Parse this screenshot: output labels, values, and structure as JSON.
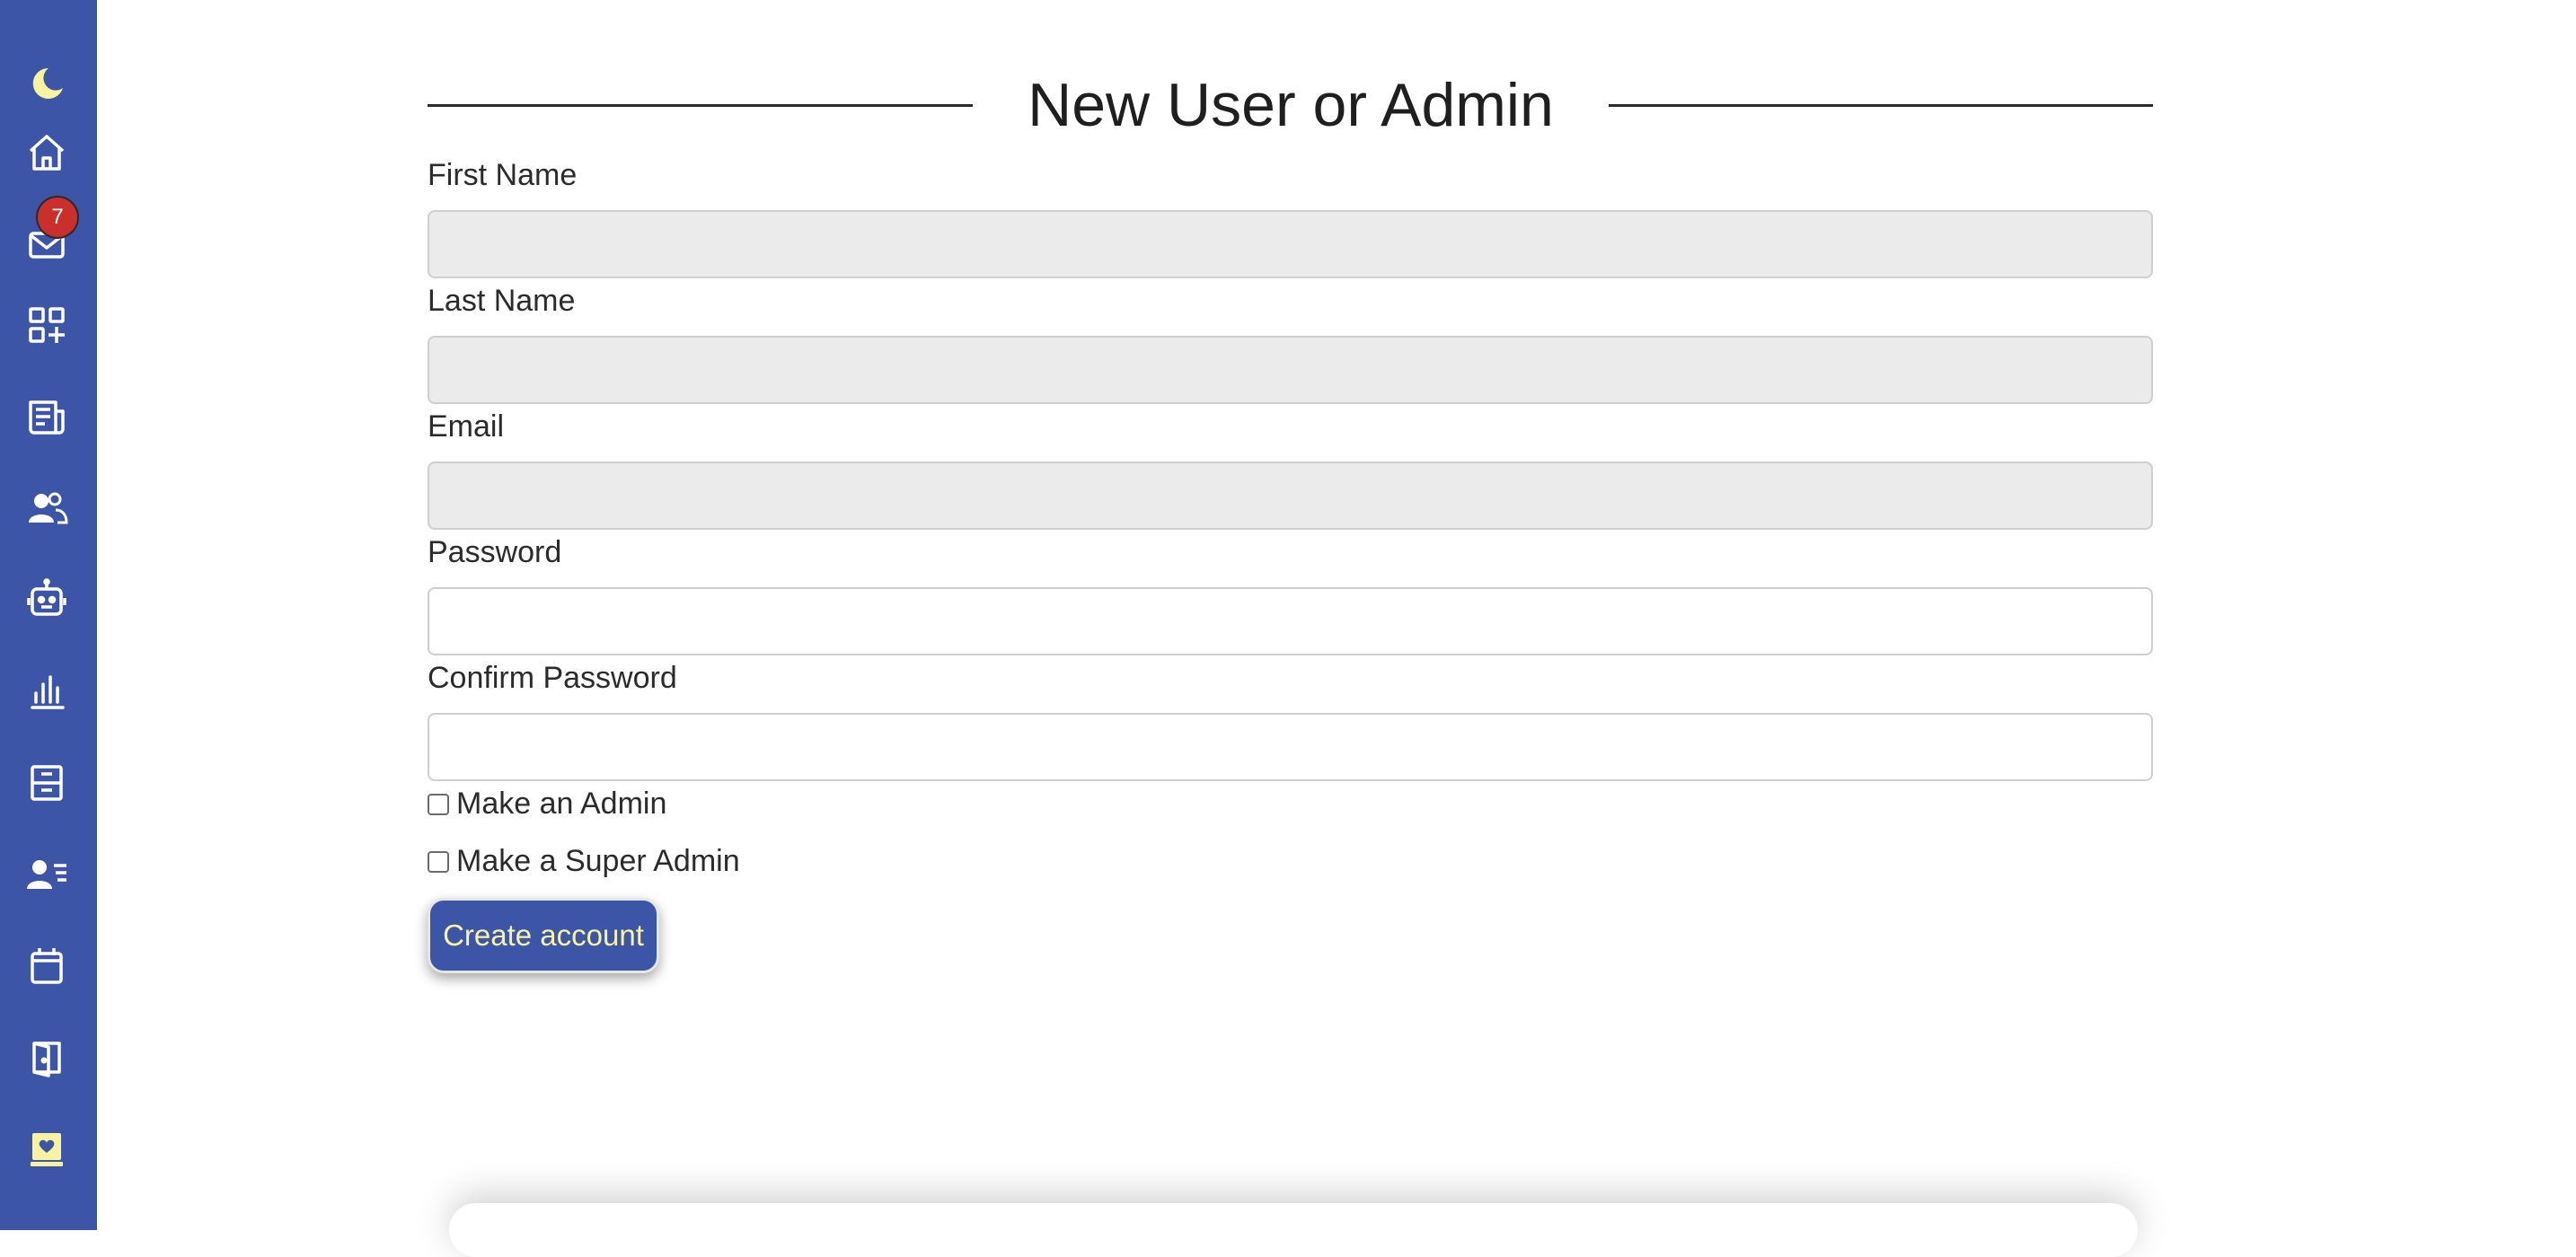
{
  "colors": {
    "sidebar": "#3d55a6",
    "icon": "#ffffff",
    "moon": "#f7f3a0",
    "badge": "#c9302c",
    "button": "#3d55a6",
    "button_text": "#f7f3a0",
    "input_disabled": "#ebebeb"
  },
  "sidebar": {
    "items": [
      {
        "icon": "moon-icon"
      },
      {
        "icon": "home-icon"
      },
      {
        "icon": "mail-icon",
        "badge": "7"
      },
      {
        "icon": "apps-add-icon"
      },
      {
        "icon": "newspaper-icon"
      },
      {
        "icon": "people-icon"
      },
      {
        "icon": "robot-icon"
      },
      {
        "icon": "bar-chart-icon"
      },
      {
        "icon": "archive-icon"
      },
      {
        "icon": "person-lines-icon"
      },
      {
        "icon": "calendar-icon"
      },
      {
        "icon": "door-exit-icon"
      },
      {
        "icon": "journal-heart-icon"
      }
    ]
  },
  "form": {
    "title": "New User or Admin",
    "first_name_label": "First Name",
    "first_name_value": "",
    "last_name_label": "Last Name",
    "last_name_value": "",
    "email_label": "Email",
    "email_value": "",
    "password_label": "Password",
    "password_value": "",
    "confirm_password_label": "Confirm Password",
    "confirm_password_value": "",
    "make_admin_label": "Make an Admin",
    "make_super_admin_label": "Make a Super Admin",
    "submit_label": "Create account"
  }
}
